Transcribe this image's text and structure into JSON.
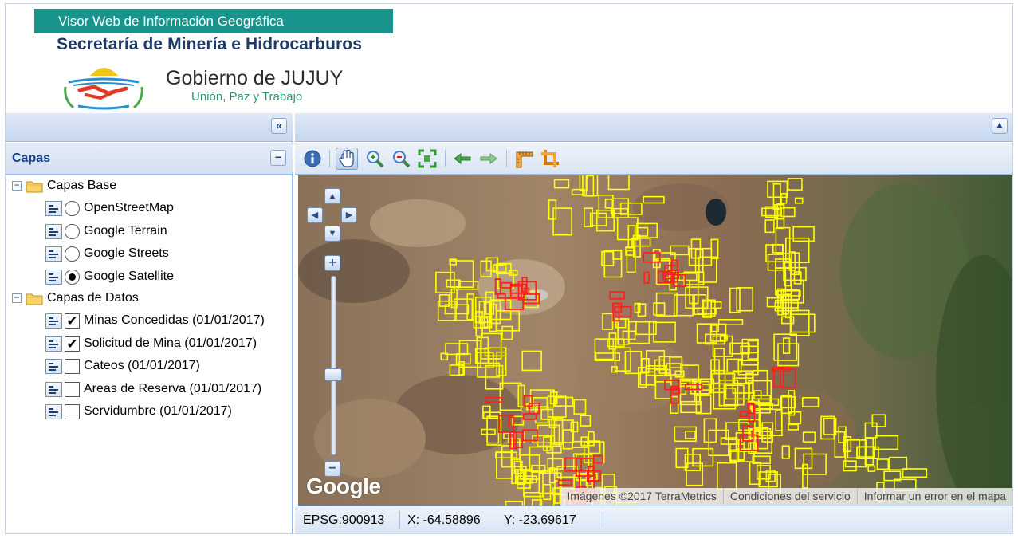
{
  "header": {
    "banner": "Visor Web de Información Geográfica",
    "secretaria": "Secretaría de Minería e Hidrocarburos",
    "gobierno": "Gobierno de JUJUY",
    "lema": "Unión, Paz y Trabajo"
  },
  "west_panel": {
    "collapse_icon": "«",
    "title": "Capas",
    "collapse_title_icon": "−",
    "groups": [
      {
        "label": "Capas Base",
        "expander": "−"
      },
      {
        "label": "Capas de Datos",
        "expander": "−"
      }
    ],
    "base_layers": [
      {
        "label": "OpenStreetMap",
        "selected": false
      },
      {
        "label": "Google Terrain",
        "selected": false
      },
      {
        "label": "Google Streets",
        "selected": false
      },
      {
        "label": "Google Satellite",
        "selected": true
      }
    ],
    "data_layers": [
      {
        "label": "Minas Concedidas (01/01/2017)",
        "checked": true,
        "mark": "✔"
      },
      {
        "label": "Solicitud de Mina (01/01/2017)",
        "checked": true,
        "mark": "✔"
      },
      {
        "label": "Cateos (01/01/2017)",
        "checked": false,
        "mark": ""
      },
      {
        "label": "Areas de Reserva (01/01/2017)",
        "checked": false,
        "mark": ""
      },
      {
        "label": "Servidumbre (01/01/2017)",
        "checked": false,
        "mark": ""
      }
    ]
  },
  "toolbar": {
    "tools": [
      "info-icon",
      "pan-hand-icon",
      "zoom-in-icon",
      "zoom-out-icon",
      "zoom-extent-icon",
      "back-arrow-icon",
      "forward-arrow-icon",
      "measure-length-icon",
      "measure-area-icon"
    ],
    "active_tool": "pan-hand-icon"
  },
  "map": {
    "nav": {
      "up": "▲",
      "down": "▼",
      "left": "◀",
      "right": "▶",
      "zoom_in": "+",
      "zoom_out": "−"
    },
    "zoom_level_fraction": 0.45,
    "logo": "Google",
    "attribution": [
      "Imágenes ©2017 TerraMetrics",
      "Condiciones del servicio",
      "Informar un error en el mapa"
    ],
    "colors": {
      "minas": "#ffff00",
      "solicitudes": "#ff2020"
    }
  },
  "status": {
    "epsg": "EPSG:900913",
    "x": "X: -64.58896",
    "y": "Y: -23.69617"
  }
}
